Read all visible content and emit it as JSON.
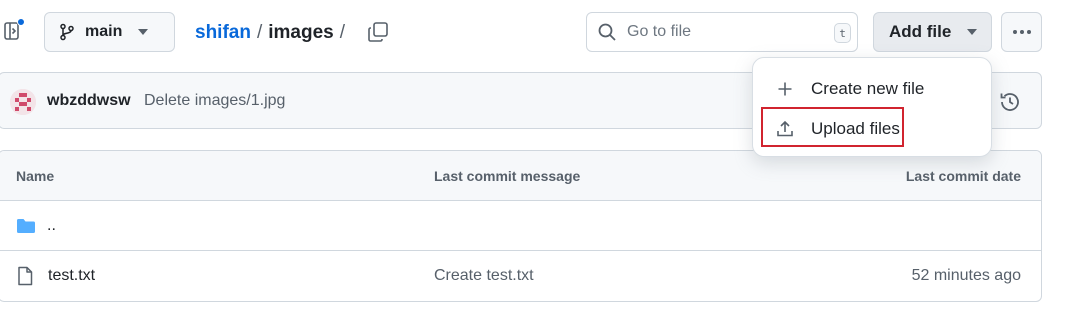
{
  "header": {
    "branch_label": "main",
    "breadcrumb_owner": "shifan",
    "breadcrumb_sep1": "/",
    "breadcrumb_dir": "images",
    "breadcrumb_sep2": "/",
    "search_placeholder": "Go to file",
    "search_shortcut": "t",
    "add_file_label": "Add file"
  },
  "commit": {
    "user": "wbzddwsw",
    "message": "Delete images/1.jpg"
  },
  "table": {
    "columns": [
      "Name",
      "Last commit message",
      "Last commit date"
    ],
    "rows": [
      {
        "name": "..",
        "message": "",
        "date": "",
        "icon": "folder-icon"
      },
      {
        "name": "test.txt",
        "message": "Create test.txt",
        "date": "52 minutes ago",
        "icon": "file-icon"
      }
    ]
  },
  "menu": {
    "items": [
      {
        "label": "Create new file",
        "icon": "plus-icon"
      },
      {
        "label": "Upload files",
        "icon": "upload-icon"
      }
    ]
  },
  "colors": {
    "link": "#0969da",
    "folder": "#54aeff",
    "highlight": "#d1242f"
  }
}
